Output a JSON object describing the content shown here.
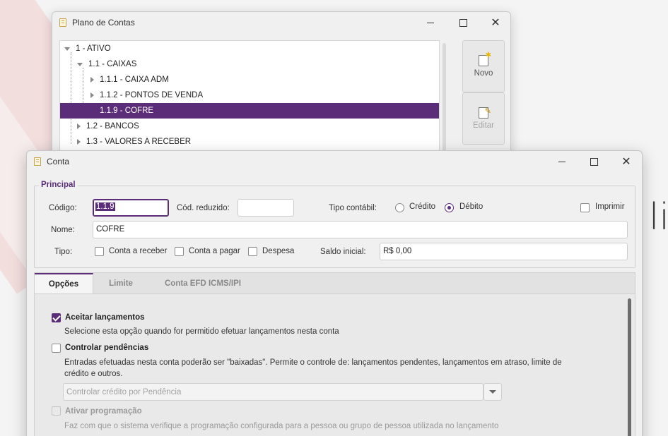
{
  "desktop": {
    "partial_text": "li"
  },
  "back_window": {
    "title": "Plano de Contas",
    "tree": [
      {
        "label": "1 - ATIVO"
      },
      {
        "label": "1.1 - CAIXAS"
      },
      {
        "label": "1.1.1 - CAIXA ADM"
      },
      {
        "label": "1.1.2 - PONTOS DE VENDA"
      },
      {
        "label": "1.1.9 - COFRE"
      },
      {
        "label": "1.2 - BANCOS"
      },
      {
        "label": "1.3 - VALORES A RECEBER"
      }
    ],
    "buttons": {
      "novo": "Novo",
      "editar": "Editar"
    }
  },
  "front_window": {
    "title": "Conta",
    "principal": {
      "legend": "Principal",
      "codigo_label": "Código:",
      "codigo_value": "1.1.9",
      "cod_reduzido_label": "Cód. reduzido:",
      "cod_reduzido_value": "",
      "tipo_contabil_label": "Tipo contábil:",
      "credito_label": "Crédito",
      "debito_label": "Débito",
      "imprimir_label": "Imprimir",
      "nome_label": "Nome:",
      "nome_value": "COFRE",
      "tipo_label": "Tipo:",
      "conta_receber_label": "Conta a receber",
      "conta_pagar_label": "Conta a pagar",
      "despesa_label": "Despesa",
      "saldo_label": "Saldo inicial:",
      "saldo_value": "R$ 0,00"
    },
    "tabs": [
      "Opções",
      "Limite",
      "Conta EFD ICMS/IPI"
    ],
    "options": {
      "aceitar_title": "Aceitar lançamentos",
      "aceitar_desc": "Selecione esta opção quando for permitido efetuar lançamentos nesta conta",
      "controlar_title": "Controlar pendências",
      "controlar_desc": "Entradas efetuadas nesta conta poderão ser \"baixadas\". Permite o controle de: lançamentos pendentes, lançamentos em atraso, limite de crédito e outros.",
      "combo_value": "Controlar crédito por Pendência",
      "ativar_title": "Ativar programação",
      "ativar_desc": "Faz com que o sistema verifique a programação configurada para a pessoa ou grupo de pessoa utilizada no lançamento"
    }
  }
}
